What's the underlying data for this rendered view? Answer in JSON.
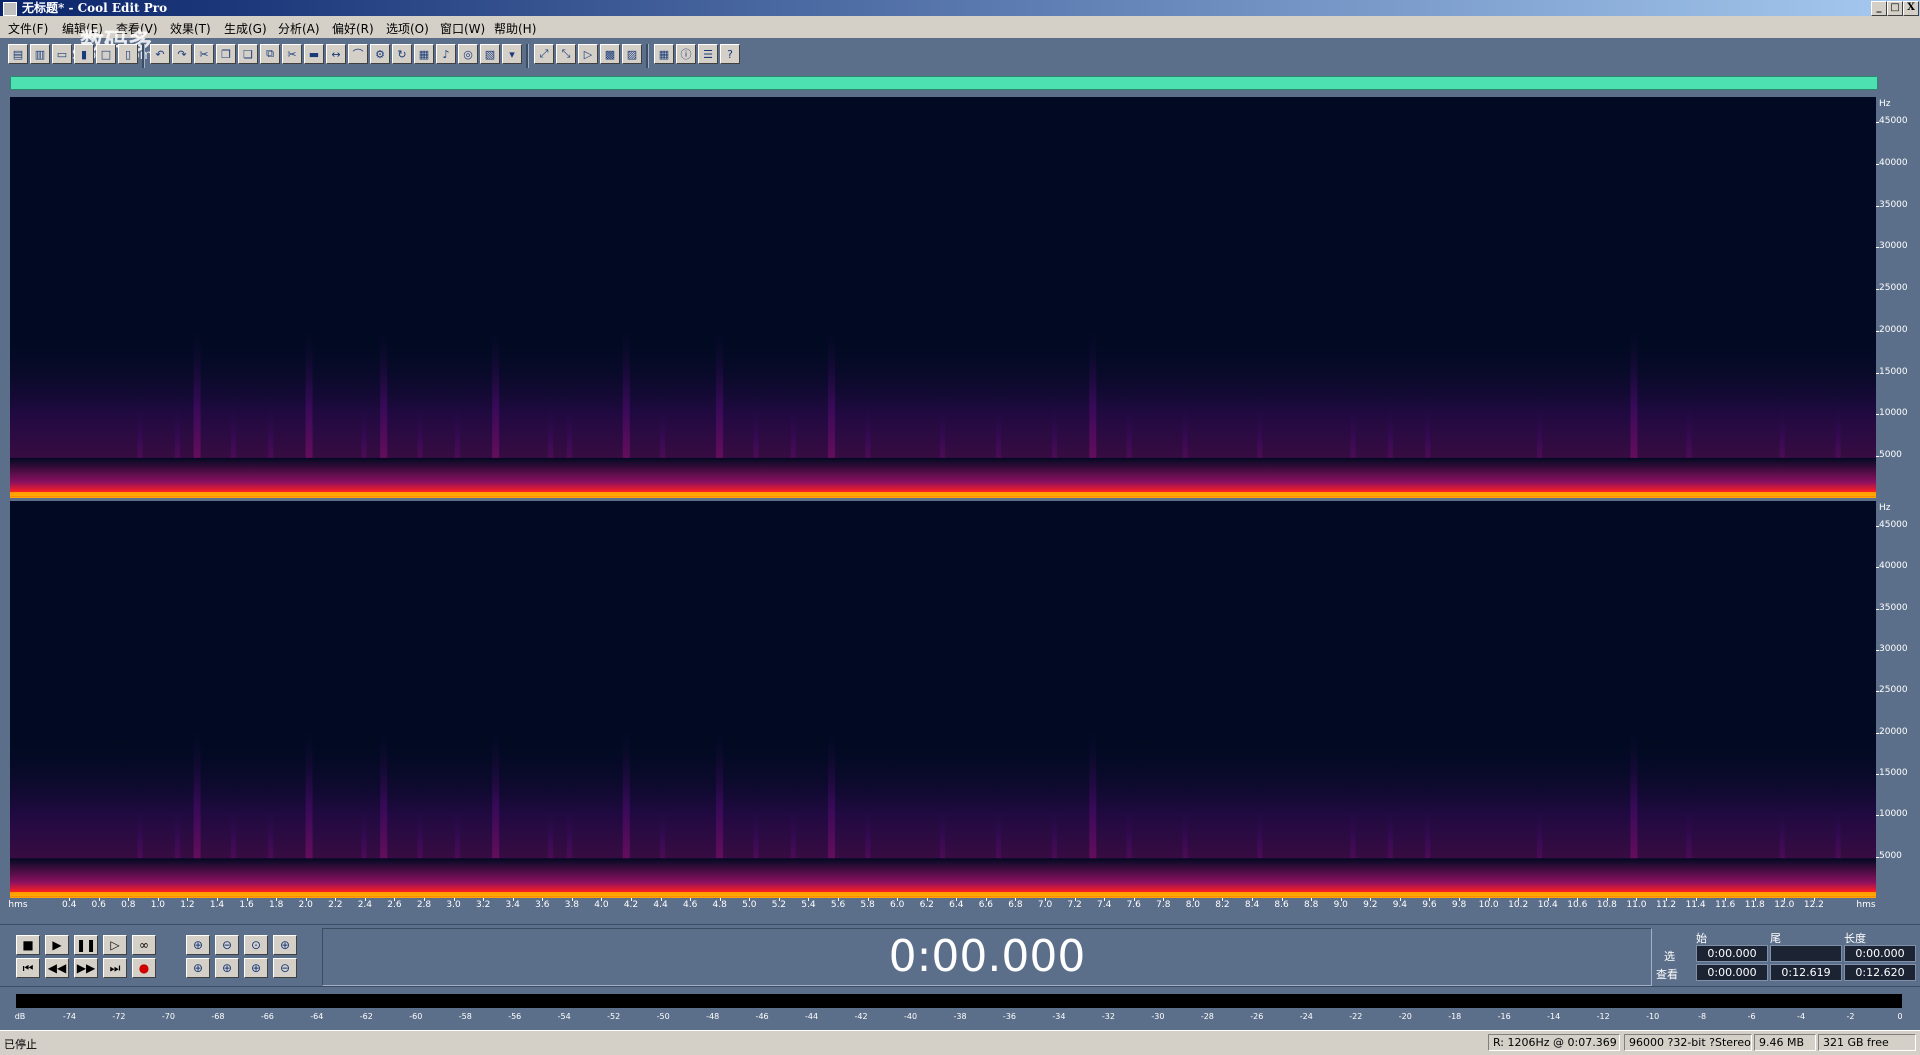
{
  "window": {
    "title": "无标题* - Cool Edit Pro",
    "controls": [
      "_",
      "□",
      "X"
    ]
  },
  "menu": [
    {
      "label": "文件(F)"
    },
    {
      "label": "编辑(E)"
    },
    {
      "label": "查看(V)"
    },
    {
      "label": "效果(T)"
    },
    {
      "label": "生成(G)"
    },
    {
      "label": "分析(A)"
    },
    {
      "label": "偏好(R)"
    },
    {
      "label": "选项(O)"
    },
    {
      "label": "窗口(W)"
    },
    {
      "label": "帮助(H)"
    }
  ],
  "watermark": {
    "text1": "数码多",
    "text2": "Soomal.com"
  },
  "toolbar": {
    "icons": [
      "waveform-view-icon",
      "multitrack-view-icon",
      "open-icon",
      "save-icon",
      "new-icon",
      "close-icon",
      "undo-icon",
      "redo-icon",
      "cut-icon",
      "copy-icon",
      "paste-icon",
      "mix-paste-icon",
      "trim-icon",
      "silence-icon",
      "split-icon",
      "envelope-icon",
      "settings-icon",
      "loop-icon",
      "spectral-icon",
      "pitch-icon",
      "cd-icon",
      "stats-icon",
      "marker-icon",
      "zoom-full-icon",
      "zoom-sel-icon",
      "play-view-icon",
      "chart-icon",
      "format-icon",
      "grid-icon",
      "info-icon",
      "properties-icon",
      "help-icon"
    ]
  },
  "spectrogram": {
    "freq_unit": "Hz",
    "freq_labels": [
      "45000",
      "40000",
      "35000",
      "30000",
      "25000",
      "20000",
      "15000",
      "10000",
      "5000"
    ],
    "time_unit": "hms",
    "time_labels": [
      "0.4",
      "0.6",
      "0.8",
      "1.0",
      "1.2",
      "1.4",
      "1.6",
      "1.8",
      "2.0",
      "2.2",
      "2.4",
      "2.6",
      "2.8",
      "3.0",
      "3.2",
      "3.4",
      "3.6",
      "3.8",
      "4.0",
      "4.2",
      "4.4",
      "4.6",
      "4.8",
      "5.0",
      "5.2",
      "5.4",
      "5.6",
      "5.8",
      "6.0",
      "6.2",
      "6.4",
      "6.6",
      "6.8",
      "7.0",
      "7.2",
      "7.4",
      "7.6",
      "7.8",
      "8.0",
      "8.2",
      "8.4",
      "8.6",
      "8.8",
      "9.0",
      "9.2",
      "9.4",
      "9.6",
      "9.8",
      "10.0",
      "10.2",
      "10.4",
      "10.6",
      "10.8",
      "11.0",
      "11.2",
      "11.4",
      "11.6",
      "11.8",
      "12.0",
      "12.2"
    ],
    "colors": {
      "bg": "#010a22",
      "low": "#3a0a5a",
      "mid": "#8a1060",
      "hot": "#ff2020",
      "peak": "#ffb000"
    }
  },
  "transport": {
    "time_display": "0:00.000",
    "buttons_row1": [
      "stop-icon",
      "play-icon",
      "pause-icon",
      "play-to-end-icon",
      "loop-play-icon"
    ],
    "buttons_row2": [
      "go-start-icon",
      "rewind-icon",
      "fast-forward-icon",
      "go-end-icon",
      "record-icon"
    ],
    "zoom_row1": [
      "zoom-in-h-icon",
      "zoom-out-h-icon",
      "zoom-full-h-icon",
      "zoom-in-v-icon"
    ],
    "zoom_row2": [
      "zoom-sel-icon",
      "zoom-left-icon",
      "zoom-right-icon",
      "zoom-out-v-icon"
    ]
  },
  "selection": {
    "head_begin": "始",
    "head_end": "尾",
    "head_length": "长度",
    "row_sel": "选",
    "row_view": "查看",
    "sel_begin": "0:00.000",
    "sel_end": "",
    "sel_length": "0:00.000",
    "view_begin": "0:00.000",
    "view_end": "0:12.619",
    "view_length": "0:12.620"
  },
  "level_meter": {
    "db_labels": [
      "dB",
      "-74",
      "-72",
      "-70",
      "-68",
      "-66",
      "-64",
      "-62",
      "-60",
      "-58",
      "-56",
      "-54",
      "-52",
      "-50",
      "-48",
      "-46",
      "-44",
      "-42",
      "-40",
      "-38",
      "-36",
      "-34",
      "-32",
      "-30",
      "-28",
      "-26",
      "-24",
      "-22",
      "-20",
      "-18",
      "-16",
      "-14",
      "-12",
      "-10",
      "-8",
      "-6",
      "-4",
      "-2",
      "0"
    ]
  },
  "status": {
    "state": "已停止",
    "cursor": "R: 1206Hz @   0:07.369",
    "format": "96000 ?32-bit ?Stereo",
    "size": "9.46 MB",
    "free": "321 GB free"
  }
}
